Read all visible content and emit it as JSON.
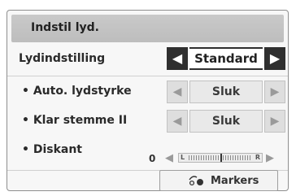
{
  "header": {
    "title": "Indstil lyd."
  },
  "sound_mode": {
    "label": "Lydindstilling",
    "value": "Standard"
  },
  "settings": [
    {
      "label": "• Auto. lydstyrke",
      "value": "Sluk"
    },
    {
      "label": "• Klar stemme II",
      "value": "Sluk"
    }
  ],
  "treble": {
    "label": "• Diskant",
    "value": "0",
    "left_mark": "L",
    "right_mark": "R"
  },
  "footer": {
    "button_label": "Markers",
    "button_icon": "remote-pointer-icon"
  },
  "colors": {
    "title_bar": "#c4c4c4",
    "active_arrow": "#2f2f2f",
    "inactive": "#dedede"
  }
}
